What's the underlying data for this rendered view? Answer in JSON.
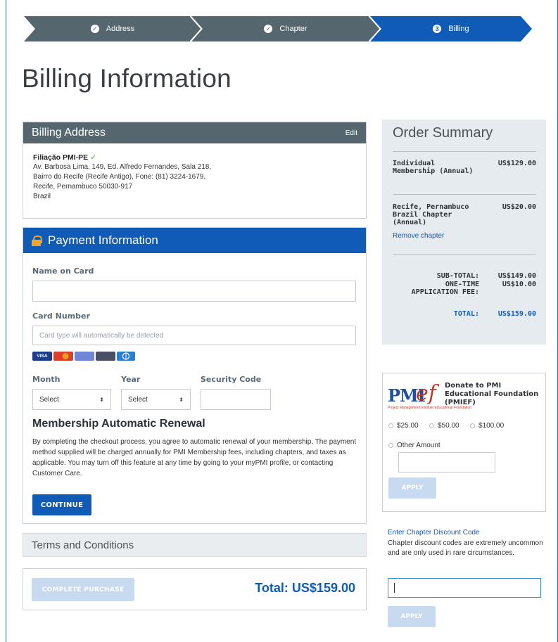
{
  "stepper": {
    "steps": [
      {
        "label": "Address",
        "state": "done"
      },
      {
        "label": "Chapter",
        "state": "done"
      },
      {
        "label": "Billing",
        "state": "current",
        "number": "3"
      }
    ]
  },
  "page_title": "Billing Information",
  "billing_address": {
    "header": "Billing Address",
    "edit_label": "Edit",
    "name": "Filiação PMI-PE",
    "lines": [
      "Av. Barbosa Lima, 149, Ed. Alfredo Fernandes, Sala 218,",
      "Bairro do Recife (Recife Antigo), Fone: (81) 3224-1679,",
      "Recife, Pernambuco 50030-917",
      "Brazil"
    ]
  },
  "payment": {
    "header": "Payment Information",
    "name_label": "Name on Card",
    "name_value": "",
    "card_label": "Card Number",
    "card_placeholder": "Card type will automatically be detected",
    "card_brands": [
      "VISA",
      "MC",
      "AMEX",
      "DISCOVER",
      "DINERS"
    ],
    "month_label": "Month",
    "month_value": "Select",
    "year_label": "Year",
    "year_value": "Select",
    "security_label": "Security Code",
    "renew_title": "Membership Automatic Renewal",
    "renew_text": "By completing the checkout process, you agree to automatic renewal of your membership. The payment method supplied will be charged annually for PMI Membership fees, including chapters, and taxes as applicable. You may turn off this feature at any time by going to your myPMI profile, or contacting Customer Care.",
    "continue_label": "CONTINUE"
  },
  "terms_label": "Terms and Conditions",
  "complete_label": "COMPLETE PURCHASE",
  "total_label": "Total: US$159.00",
  "summary": {
    "title": "Order Summary",
    "items": [
      {
        "name": "Individual Membership (Annual)",
        "price": "US$129.00"
      },
      {
        "name": "Recife, Pernambuco Brazil Chapter (Annual)",
        "price": "US$20.00"
      }
    ],
    "remove_label": "Remove chapter",
    "subtotal_label": "SUB-TOTAL:",
    "subtotal_value": "US$149.00",
    "fee_label": "ONE-TIME APPLICATION FEE:",
    "fee_value": "US$10.00",
    "total_label": "TOTAL:",
    "total_value": "US$159.00"
  },
  "donate": {
    "logo_text": "PMI",
    "logo_ef": "ef",
    "logo_small": "Project Management Institute Educational Foundation",
    "title": "Donate to PMI Educational Foundation (PMIEF)",
    "amounts": [
      "$25.00",
      "$50.00",
      "$100.00"
    ],
    "other_label": "Other Amount",
    "apply_label": "APPLY"
  },
  "discount": {
    "link": "Enter Chapter Discount Code",
    "text": "Chapter discount codes are extremely uncommon and are only used in rare circumstances.",
    "apply_label": "APPLY"
  },
  "colors": {
    "primary": "#0f5bb6",
    "step_done": "#56666f",
    "disabled": "#c8daf0"
  }
}
